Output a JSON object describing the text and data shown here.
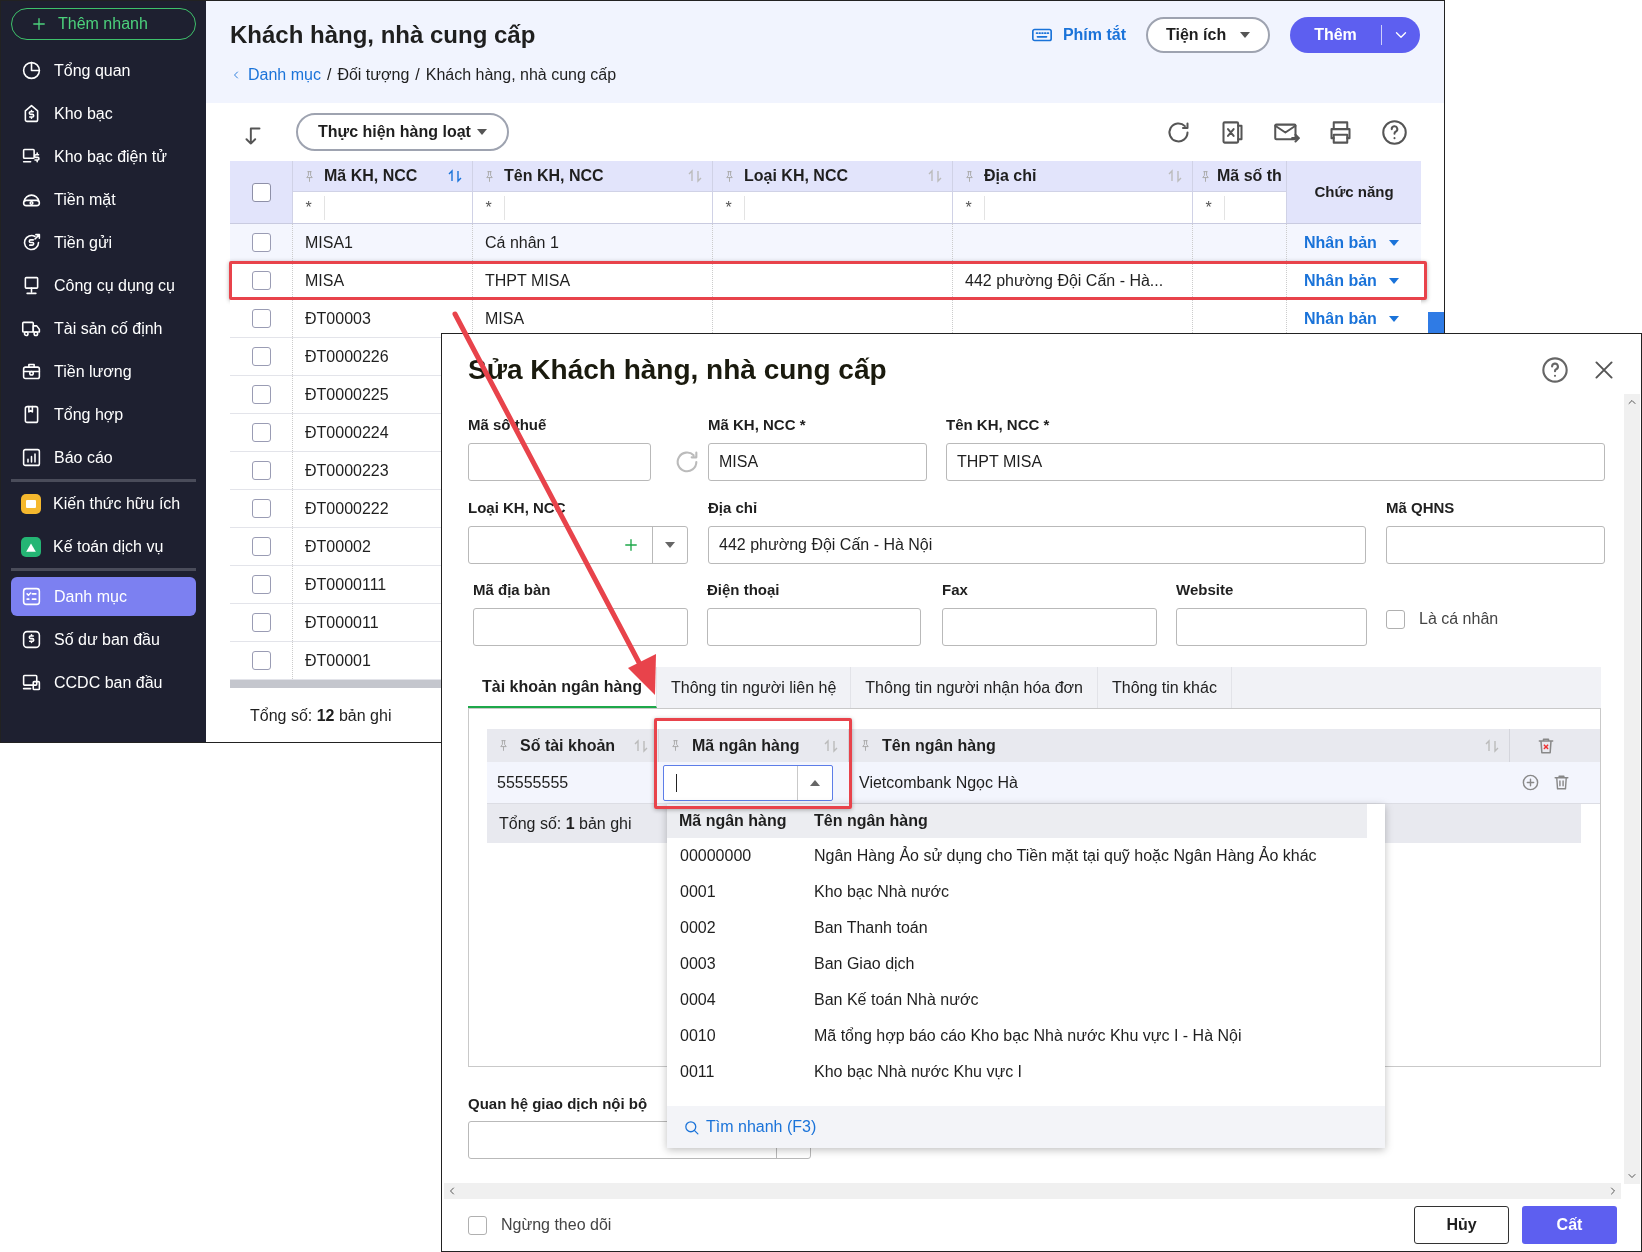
{
  "sidebar": {
    "quick_add": "Thêm nhanh",
    "groups": [
      [
        {
          "label": "Tổng quan",
          "kind": "pie",
          "selected": false
        },
        {
          "label": "Kho bạc",
          "kind": "safe",
          "selected": false
        },
        {
          "label": "Kho bạc điện tử",
          "kind": "ebank",
          "selected": false
        },
        {
          "label": "Tiền mặt",
          "kind": "cash",
          "selected": false
        },
        {
          "label": "Tiền gửi",
          "kind": "deposit",
          "selected": false
        },
        {
          "label": "Công cụ dụng cụ",
          "kind": "tool",
          "selected": false
        },
        {
          "label": "Tài sản cố định",
          "kind": "truck",
          "selected": false
        },
        {
          "label": "Tiền lương",
          "kind": "salary",
          "selected": false
        },
        {
          "label": "Tổng hợp",
          "kind": "book",
          "selected": false
        },
        {
          "label": "Báo cáo",
          "kind": "report",
          "selected": false
        }
      ],
      [
        {
          "label": "Kiến thức hữu ích",
          "kind": "app_yellow",
          "selected": false
        },
        {
          "label": "Kế toán dịch vụ",
          "kind": "app_green",
          "selected": false
        }
      ],
      [
        {
          "label": "Danh mục",
          "kind": "list",
          "selected": true
        },
        {
          "label": "Số dư ban đầu",
          "kind": "balance",
          "selected": false
        },
        {
          "label": "CCDC ban đầu",
          "kind": "devices",
          "selected": false
        }
      ]
    ]
  },
  "page": {
    "title": "Khách hàng, nhà cung cấp",
    "breadcrumb": [
      {
        "label": "Danh mục",
        "kind": "link"
      },
      {
        "label": "Đối tượng",
        "kind": "text"
      },
      {
        "label": "Khách hàng, nhà cung cấp",
        "kind": "text"
      }
    ],
    "breadcrumb_separator": "/",
    "shortcuts": "Phím tắt",
    "utilities": "Tiện ích",
    "add": "Thêm",
    "bulk_action": "Thực hiện hàng loạt"
  },
  "table": {
    "columns": [
      {
        "label": "Mã KH, NCC",
        "filter": "*",
        "sort_active": true
      },
      {
        "label": "Tên KH, NCC",
        "filter": "*",
        "sort_active": false
      },
      {
        "label": "Loại KH, NCC",
        "filter": "*",
        "sort_active": false
      },
      {
        "label": "Địa chỉ",
        "filter": "*",
        "sort_active": false
      },
      {
        "label": "Mã số th",
        "filter": "*"
      }
    ],
    "all_selected": false,
    "action_column": "Chức năng",
    "rows": [
      {
        "selected": false,
        "highlighted": false,
        "code": "MISA1",
        "name": "Cá nhân 1",
        "action": "Nhân bản"
      },
      {
        "selected": false,
        "highlighted": true,
        "code": "MISA",
        "name": "THPT MISA",
        "address": "442 phường Đội Cấn - Hà...",
        "action": "Nhân bản"
      },
      {
        "selected": false,
        "highlighted": false,
        "code": "ĐT00003",
        "name": "MISA",
        "action": "Nhân bản"
      },
      {
        "selected": false,
        "highlighted": false,
        "code": "ĐT0000226"
      },
      {
        "selected": false,
        "highlighted": false,
        "code": "ĐT0000225"
      },
      {
        "selected": false,
        "highlighted": false,
        "code": "ĐT0000224"
      },
      {
        "selected": false,
        "highlighted": false,
        "code": "ĐT0000223"
      },
      {
        "selected": false,
        "highlighted": false,
        "code": "ĐT0000222"
      },
      {
        "selected": false,
        "highlighted": false,
        "code": "ĐT00002"
      },
      {
        "selected": false,
        "highlighted": false,
        "code": "ĐT0000111"
      },
      {
        "selected": false,
        "highlighted": false,
        "code": "ĐT000011"
      },
      {
        "selected": false,
        "highlighted": false,
        "code": "ĐT00001"
      }
    ],
    "footer": "Tổng số: **12** bản ghi"
  },
  "dialog": {
    "title": "Sửa Khách hàng, nhà cung cấp",
    "field_rows": [
      [
        {
          "label": "Mã số thuế",
          "kind": "tax"
        },
        {
          "label": "Mã KH, NCC *",
          "kind": "text",
          "value": "MISA"
        },
        {
          "label": "Tên KH, NCC *",
          "kind": "text",
          "value": "THPT MISA"
        }
      ],
      [
        {
          "label": "Loại KH, NCC",
          "kind": "combo_add"
        },
        {
          "label": "Địa chỉ",
          "kind": "text",
          "value": "442 phường Đội Cấn - Hà Nội"
        },
        {
          "label": "Mã QHNS",
          "kind": "text"
        }
      ],
      [
        {
          "label": "Mã địa bàn",
          "kind": "text"
        },
        {
          "label": "Điện thoại",
          "kind": "text"
        },
        {
          "label": "Fax",
          "kind": "text"
        },
        {
          "label": "Website",
          "kind": "text"
        },
        {
          "label": "Là cá nhân",
          "kind": "checkbox",
          "checked": false
        }
      ]
    ],
    "tabs": [
      {
        "label": "Tài khoản ngân hàng",
        "selected": true
      },
      {
        "label": "Thông tin người liên hệ",
        "selected": false
      },
      {
        "label": "Thông tin người nhận hóa đơn",
        "selected": false
      },
      {
        "label": "Thông tin khác",
        "selected": false
      }
    ],
    "bank_grid": {
      "columns": [
        "Số tài khoản",
        "Mã ngân hàng",
        "Tên ngân hàng"
      ],
      "rows": [
        {
          "account": "55555555",
          "bank_name": "Vietcombank Ngọc Hà"
        }
      ],
      "footer": "Tổng số: **1** bản ghi"
    },
    "bank_dropdown": {
      "columns": [
        "Mã ngân hàng",
        "Tên ngân hàng"
      ],
      "items": [
        {
          "code": "00000000",
          "name": "Ngân Hàng Ảo sử dụng cho Tiền mặt tại quỹ hoặc Ngân Hàng Ảo khác"
        },
        {
          "code": "0001",
          "name": "Kho bạc Nhà nước"
        },
        {
          "code": "0002",
          "name": "Ban Thanh toán"
        },
        {
          "code": "0003",
          "name": "Ban Giao dịch"
        },
        {
          "code": "0004",
          "name": "Ban Kế toán Nhà nước"
        },
        {
          "code": "0010",
          "name": "Mã tổng hợp báo cáo Kho bạc Nhà nước Khu vực I - Hà Nội"
        },
        {
          "code": "0011",
          "name": "Kho bạc Nhà nước Khu vực I"
        }
      ],
      "search": "Tìm nhanh (F3)"
    },
    "internal_relation": {
      "label": "Quan hệ giao dịch nội bộ"
    },
    "stop_tracking": {
      "label": "Ngừng theo dõi",
      "checked": false
    },
    "cancel": "Hủy",
    "save": "Cất"
  }
}
